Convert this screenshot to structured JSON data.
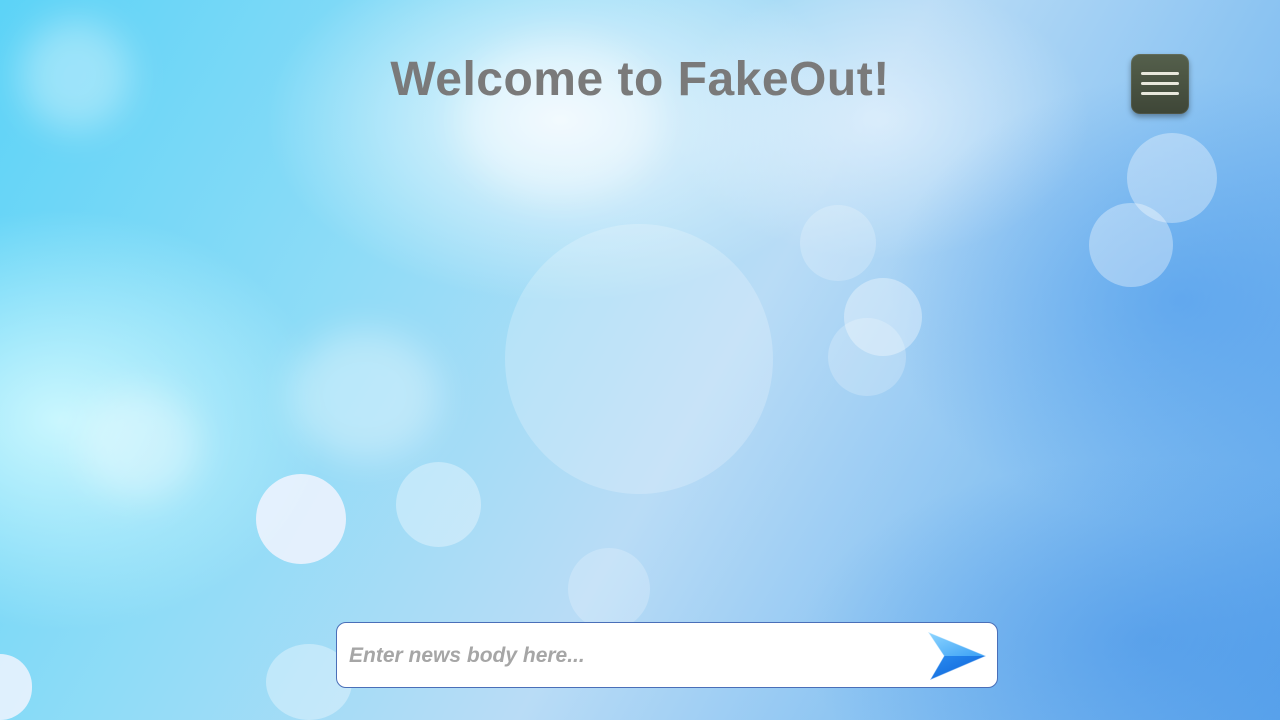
{
  "header": {
    "title": "Welcome to FakeOut!"
  },
  "menu": {
    "icon": "hamburger-menu-icon"
  },
  "news_form": {
    "input_value": "",
    "input_placeholder": "Enter news body here...",
    "submit_icon": "send-arrow-icon"
  },
  "colors": {
    "title_text": "#7a7a7a",
    "menu_button": "#444c3d",
    "input_border": "#4a6fb8",
    "send_arrow": "#2a8cf0"
  }
}
